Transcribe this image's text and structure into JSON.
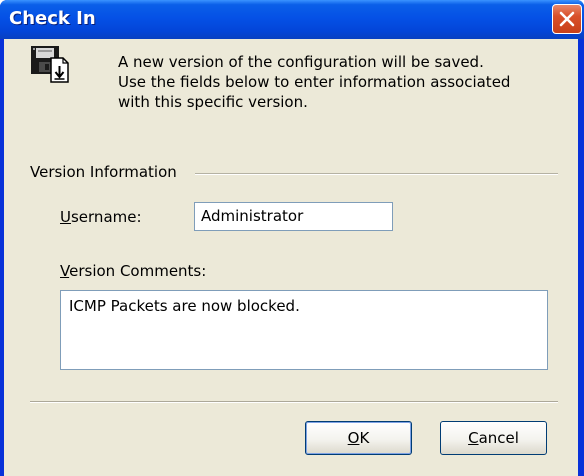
{
  "window": {
    "title": "Check In"
  },
  "intro": {
    "lines": [
      "A new version of the configuration will be saved.",
      "Use the fields below to enter information associated",
      "with this specific version."
    ]
  },
  "version_info": {
    "group_label": "Version Information",
    "username_label_first": "U",
    "username_label_rest": "sername:",
    "username_value": "Administrator",
    "comments_label_first": "V",
    "comments_label_rest": "ersion Comments:",
    "comments_value": "ICMP Packets are now blocked."
  },
  "buttons": {
    "ok_first": "O",
    "ok_rest": "K",
    "cancel_first": "C",
    "cancel_rest": "ancel"
  },
  "icons": {
    "header_icon": "floppy-disk-checkin-icon",
    "close_icon": "close-icon"
  },
  "colors": {
    "titlebar_blue": "#0551e6",
    "close_red": "#d9502a",
    "dialog_face": "#ece9d8"
  }
}
